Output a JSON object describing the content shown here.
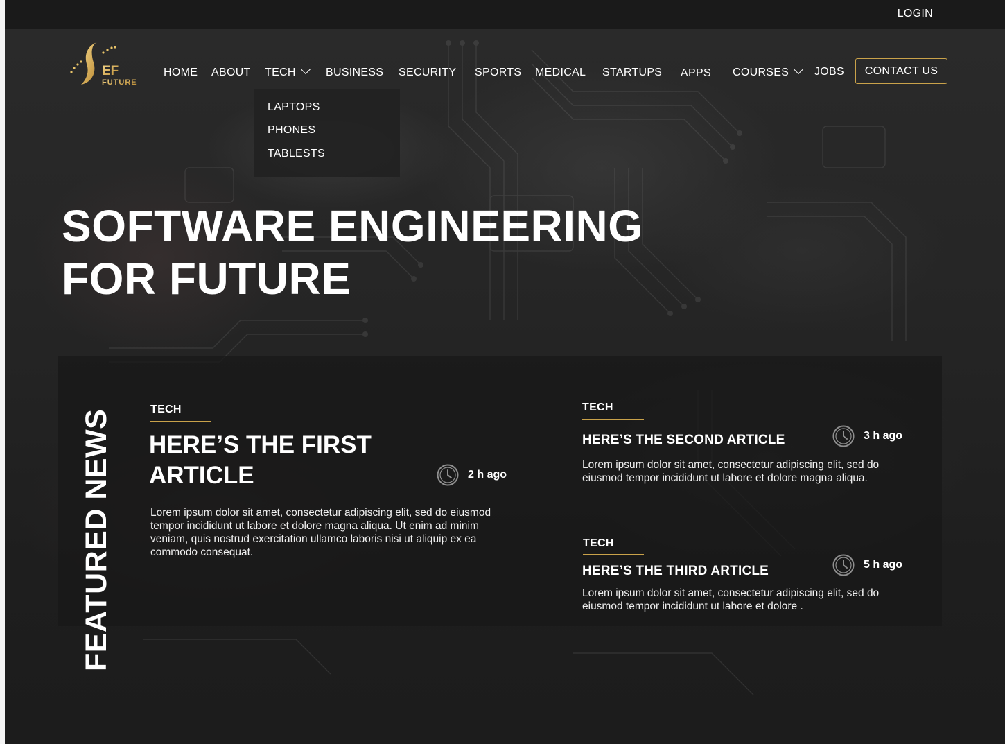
{
  "topbar": {
    "login_label": "LOGIN"
  },
  "brand": {
    "logo_text": "EF",
    "logo_subtext": "FUTURE"
  },
  "nav": {
    "items": [
      {
        "label": "HOME"
      },
      {
        "label": "ABOUT"
      },
      {
        "label": "TECH"
      },
      {
        "label": "BUSINESS"
      },
      {
        "label": "SECURITY"
      },
      {
        "label": "SPORTS"
      },
      {
        "label": "MEDICAL"
      },
      {
        "label": "STARTUPS"
      },
      {
        "label": "APPS"
      },
      {
        "label": "COURSES"
      },
      {
        "label": "JOBS"
      }
    ],
    "contact_label": "CONTACT US",
    "tech_dropdown": [
      "LAPTOPS",
      "PHONES",
      "TABLESTS"
    ]
  },
  "hero": {
    "title_line1": "SOFTWARE ENGINEERING",
    "title_line2": "FOR FUTURE"
  },
  "featured": {
    "label": "FEATURED NEWS",
    "articles": [
      {
        "category": "TECH",
        "title": "HERE’S THE FIRST ARTICLE",
        "time": "2 h ago",
        "body": "Lorem ipsum dolor sit amet, consectetur adipiscing elit, sed do eiusmod tempor incididunt ut labore et dolore magna aliqua. Ut enim ad minim veniam, quis nostrud exercitation ullamco laboris nisi ut aliquip ex ea commodo consequat."
      },
      {
        "category": "TECH",
        "title": "HERE’S THE SECOND ARTICLE",
        "time": "3 h ago",
        "body": "Lorem ipsum dolor sit amet, consectetur adipiscing elit, sed do eiusmod tempor incididunt ut labore et dolore magna aliqua."
      },
      {
        "category": "TECH",
        "title": "HERE’S THE THIRD ARTICLE",
        "time": "5 h ago",
        "body": "Lorem ipsum dolor sit amet, consectetur adipiscing elit, sed do eiusmod tempor incididunt ut labore et dolore ."
      }
    ]
  },
  "colors": {
    "accent_gold": "#c9a24a",
    "background": "#1c1c1e",
    "text": "#ffffff"
  },
  "icons": {
    "clock": "clock-icon",
    "chevron": "chevron-down-icon"
  }
}
